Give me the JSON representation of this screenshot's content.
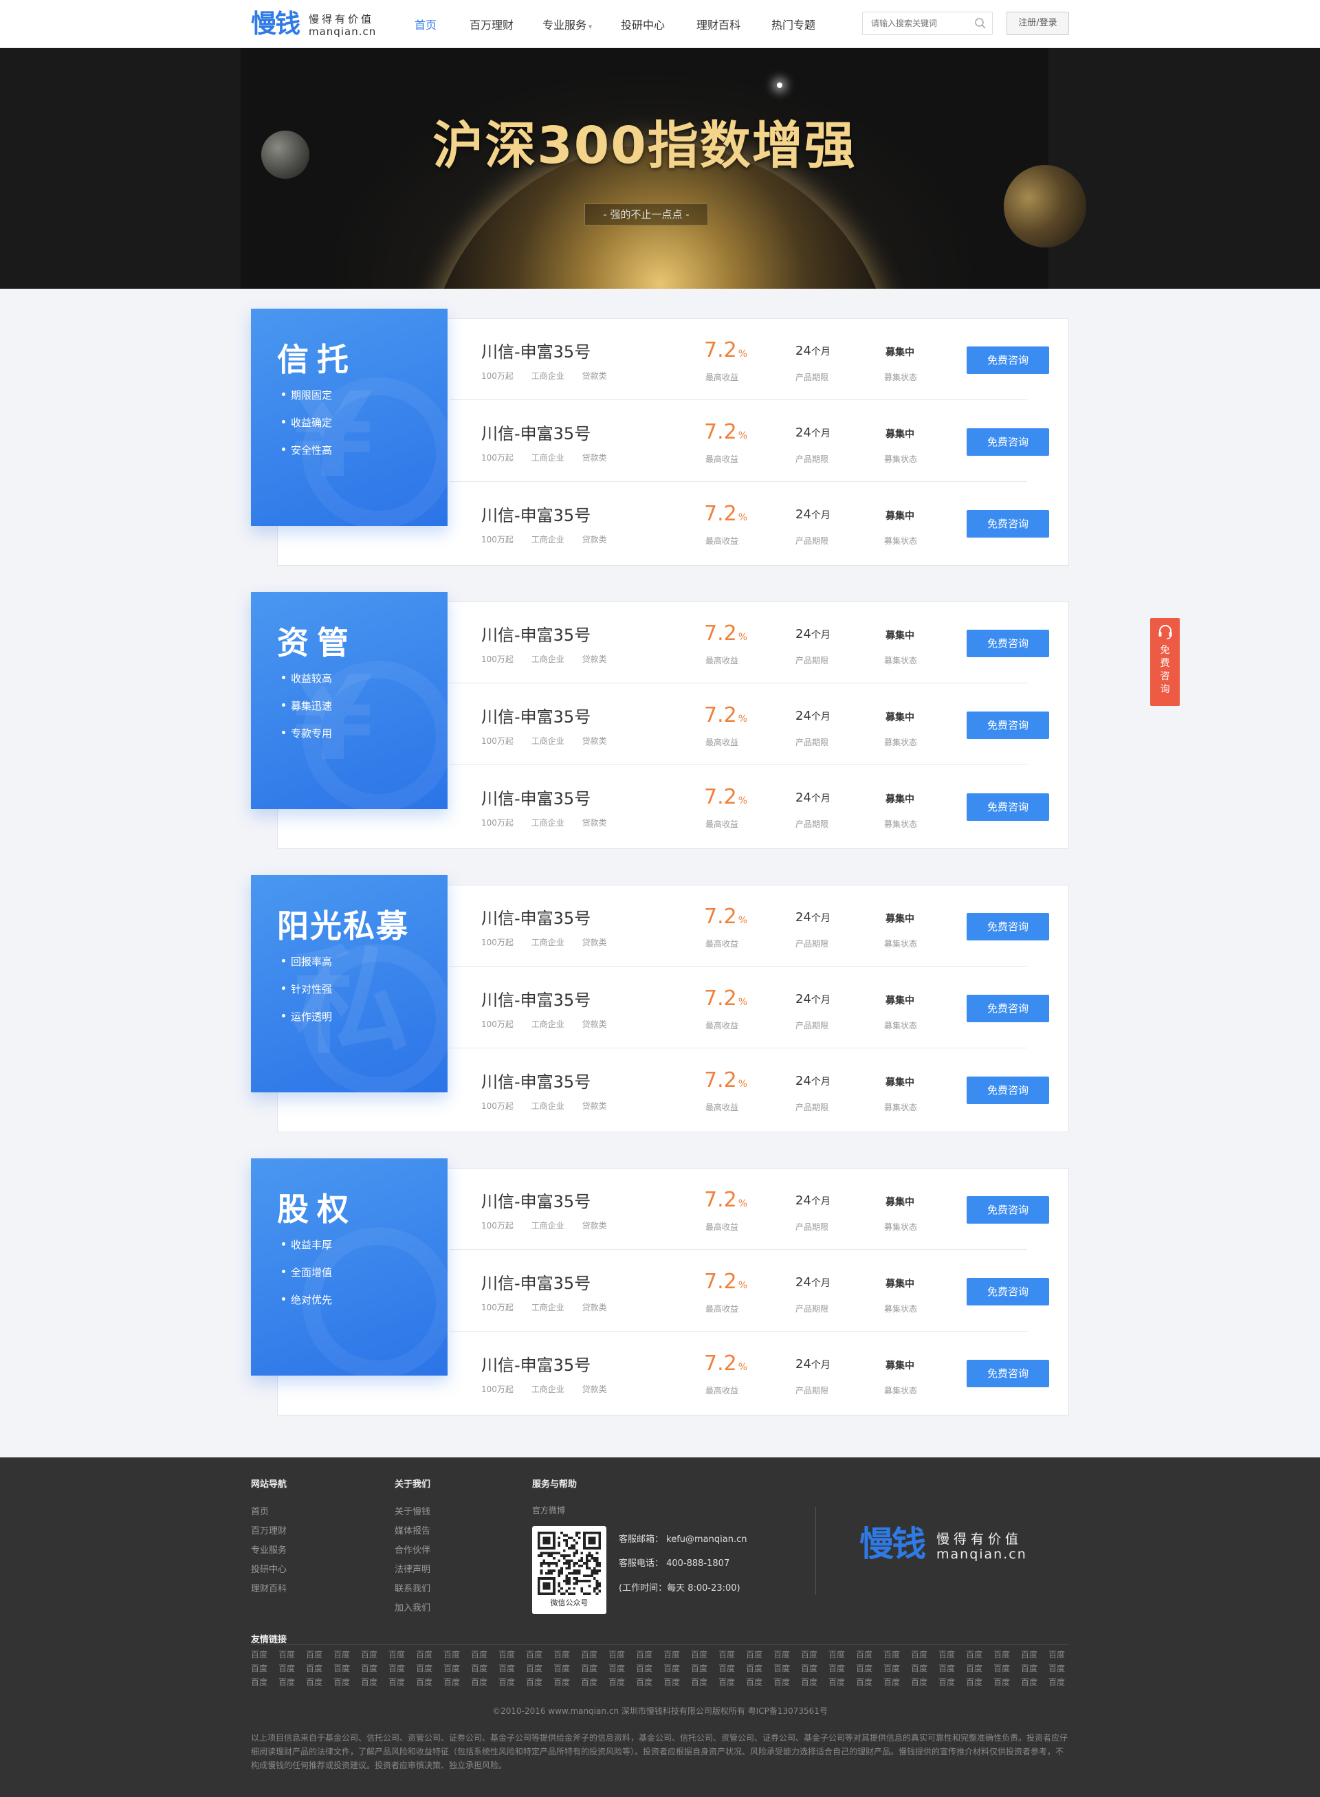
{
  "header": {
    "logo_main": "慢钱",
    "logo_slogan": "慢得有价值",
    "logo_domain": "manqian.cn",
    "nav": [
      {
        "label": "首页",
        "active": true
      },
      {
        "label": "百万理财",
        "active": false
      },
      {
        "label": "专业服务",
        "active": false,
        "has_dropdown": true
      },
      {
        "label": "投研中心",
        "active": false
      },
      {
        "label": "理财百科",
        "active": false
      },
      {
        "label": "热门专题",
        "active": false
      }
    ],
    "search_placeholder": "请输入搜索关键词",
    "login_label": "注册/登录"
  },
  "banner": {
    "title": "沪深300指数增强",
    "subtitle": "- 强的不止一点点 -"
  },
  "categories": [
    {
      "title": "信托",
      "features": [
        "期限固定",
        "收益确定",
        "安全性高"
      ],
      "watermark": "¥",
      "products": [
        {
          "name": "川信-申富35号",
          "tags": [
            "100万起",
            "工商企业",
            "贷款类"
          ],
          "rate": "7.2",
          "rate_unit": "%",
          "rate_label": "最高收益",
          "term": "24",
          "term_unit": "个月",
          "term_label": "产品期限",
          "status": "募集中",
          "status_label": "募集状态",
          "button": "免费咨询"
        },
        {
          "name": "川信-申富35号",
          "tags": [
            "100万起",
            "工商企业",
            "贷款类"
          ],
          "rate": "7.2",
          "rate_unit": "%",
          "rate_label": "最高收益",
          "term": "24",
          "term_unit": "个月",
          "term_label": "产品期限",
          "status": "募集中",
          "status_label": "募集状态",
          "button": "免费咨询"
        },
        {
          "name": "川信-申富35号",
          "tags": [
            "100万起",
            "工商企业",
            "贷款类"
          ],
          "rate": "7.2",
          "rate_unit": "%",
          "rate_label": "最高收益",
          "term": "24",
          "term_unit": "个月",
          "term_label": "产品期限",
          "status": "募集中",
          "status_label": "募集状态",
          "button": "免费咨询"
        }
      ]
    },
    {
      "title": "资管",
      "features": [
        "收益较高",
        "募集迅速",
        "专款专用"
      ],
      "watermark": "¥",
      "products": [
        {
          "name": "川信-申富35号",
          "tags": [
            "100万起",
            "工商企业",
            "贷款类"
          ],
          "rate": "7.2",
          "rate_unit": "%",
          "rate_label": "最高收益",
          "term": "24",
          "term_unit": "个月",
          "term_label": "产品期限",
          "status": "募集中",
          "status_label": "募集状态",
          "button": "免费咨询"
        },
        {
          "name": "川信-申富35号",
          "tags": [
            "100万起",
            "工商企业",
            "贷款类"
          ],
          "rate": "7.2",
          "rate_unit": "%",
          "rate_label": "最高收益",
          "term": "24",
          "term_unit": "个月",
          "term_label": "产品期限",
          "status": "募集中",
          "status_label": "募集状态",
          "button": "免费咨询"
        },
        {
          "name": "川信-申富35号",
          "tags": [
            "100万起",
            "工商企业",
            "贷款类"
          ],
          "rate": "7.2",
          "rate_unit": "%",
          "rate_label": "最高收益",
          "term": "24",
          "term_unit": "个月",
          "term_label": "产品期限",
          "status": "募集中",
          "status_label": "募集状态",
          "button": "免费咨询"
        }
      ]
    },
    {
      "title": "阳光私募",
      "features": [
        "回报率高",
        "针对性强",
        "运作透明"
      ],
      "watermark": "私",
      "products": [
        {
          "name": "川信-申富35号",
          "tags": [
            "100万起",
            "工商企业",
            "贷款类"
          ],
          "rate": "7.2",
          "rate_unit": "%",
          "rate_label": "最高收益",
          "term": "24",
          "term_unit": "个月",
          "term_label": "产品期限",
          "status": "募集中",
          "status_label": "募集状态",
          "button": "免费咨询"
        },
        {
          "name": "川信-申富35号",
          "tags": [
            "100万起",
            "工商企业",
            "贷款类"
          ],
          "rate": "7.2",
          "rate_unit": "%",
          "rate_label": "最高收益",
          "term": "24",
          "term_unit": "个月",
          "term_label": "产品期限",
          "status": "募集中",
          "status_label": "募集状态",
          "button": "免费咨询"
        },
        {
          "name": "川信-申富35号",
          "tags": [
            "100万起",
            "工商企业",
            "贷款类"
          ],
          "rate": "7.2",
          "rate_unit": "%",
          "rate_label": "最高收益",
          "term": "24",
          "term_unit": "个月",
          "term_label": "产品期限",
          "status": "募集中",
          "status_label": "募集状态",
          "button": "免费咨询"
        }
      ]
    },
    {
      "title": "股权",
      "features": [
        "收益丰厚",
        "全面增值",
        "绝对优先"
      ],
      "watermark": "",
      "products": [
        {
          "name": "川信-申富35号",
          "tags": [
            "100万起",
            "工商企业",
            "贷款类"
          ],
          "rate": "7.2",
          "rate_unit": "%",
          "rate_label": "最高收益",
          "term": "24",
          "term_unit": "个月",
          "term_label": "产品期限",
          "status": "募集中",
          "status_label": "募集状态",
          "button": "免费咨询"
        },
        {
          "name": "川信-申富35号",
          "tags": [
            "100万起",
            "工商企业",
            "贷款类"
          ],
          "rate": "7.2",
          "rate_unit": "%",
          "rate_label": "最高收益",
          "term": "24",
          "term_unit": "个月",
          "term_label": "产品期限",
          "status": "募集中",
          "status_label": "募集状态",
          "button": "免费咨询"
        },
        {
          "name": "川信-申富35号",
          "tags": [
            "100万起",
            "工商企业",
            "贷款类"
          ],
          "rate": "7.2",
          "rate_unit": "%",
          "rate_label": "最高收益",
          "term": "24",
          "term_unit": "个月",
          "term_label": "产品期限",
          "status": "募集中",
          "status_label": "募集状态",
          "button": "免费咨询"
        }
      ]
    }
  ],
  "float_consult": {
    "label": "免费咨询",
    "icon": "headset-icon"
  },
  "footer": {
    "site_nav": {
      "title": "网站导航",
      "links": [
        "首页",
        "百万理财",
        "专业服务",
        "投研中心",
        "理财百科"
      ]
    },
    "about": {
      "title": "关于我们",
      "links": [
        "关于慢钱",
        "媒体报告",
        "合作伙伴",
        "法律声明",
        "联系我们",
        "加入我们"
      ]
    },
    "service": {
      "title": "服务与帮助",
      "weibo_label": "官方微博",
      "qr_label": "微信公众号",
      "email": "客服邮箱： kefu@manqian.cn",
      "phone": "客服电话： 400-888-1807",
      "hours": "(工作时间：每天 8:00-23:00)"
    },
    "logo_main": "慢钱",
    "logo_slogan": "慢得有价值",
    "logo_domain": "manqian.cn",
    "friend_links_title": "友情链接",
    "friend_link_label": "百度",
    "friend_link_rows": 3,
    "friend_link_cols": 30,
    "copyright": "©2010-2016 www.manqian.cn 深圳市慢钱科技有限公司版权所有  粤ICP备13073561号",
    "disclaimer": "以上项目信息来自于基金公司、信托公司、资管公司、证券公司、基金子公司等提供给金斧子的信息资料，基金公司、信托公司、资管公司、证券公司、基金子公司等对其提供信息的真实可靠性和完整准确性负责。投资者应仔细阅读理财产品的法律文件，了解产品风险和收益特征（包括系统性风险和特定产品所特有的投资风险等）。投资者应根据自身资产状况、风险承受能力选择适合自己的理财产品。慢钱提供的宣传推介材料仅供投资者参考，不构成慢钱的任何推荐或投资建议。投资者应审慎决策、独立承担风险。"
  }
}
